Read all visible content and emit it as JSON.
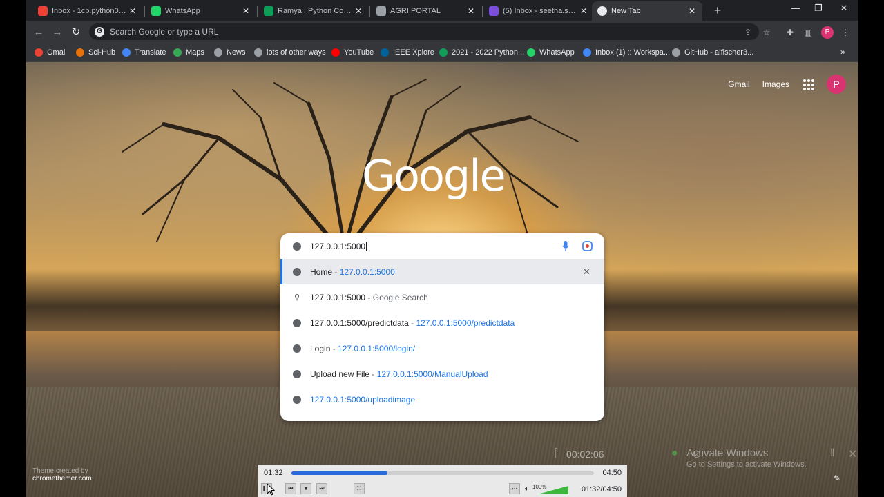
{
  "tabs": [
    {
      "title": "Inbox - 1cp.python02@",
      "favicon_color": "#ea4335",
      "active": false
    },
    {
      "title": "WhatsApp",
      "favicon_color": "#25d366",
      "active": false
    },
    {
      "title": "Ramya : Python Comm",
      "favicon_color": "#0f9d58",
      "active": false
    },
    {
      "title": "AGRI PORTAL",
      "favicon_color": "#9aa0a6",
      "active": false
    },
    {
      "title": "(5) Inbox - seetha.s@di",
      "favicon_color": "#7b4fd6",
      "active": false
    },
    {
      "title": "New Tab",
      "favicon_color": "#e8eaed",
      "active": true
    }
  ],
  "toolbar": {
    "omnibox_placeholder": "Search Google or type a URL",
    "profile_letter": "P"
  },
  "bookmarks": [
    {
      "label": "Gmail",
      "color": "#ea4335"
    },
    {
      "label": "Sci-Hub",
      "color": "#e8710a"
    },
    {
      "label": "Translate",
      "color": "#4285f4"
    },
    {
      "label": "Maps",
      "color": "#34a853"
    },
    {
      "label": "News",
      "color": "#9aa0a6"
    },
    {
      "label": "lots of other ways",
      "color": "#9aa0a6"
    },
    {
      "label": "YouTube",
      "color": "#ff0000"
    },
    {
      "label": "IEEE Xplore",
      "color": "#00629b"
    },
    {
      "label": "2021 - 2022 Python...",
      "color": "#0f9d58"
    },
    {
      "label": "WhatsApp",
      "color": "#25d366"
    },
    {
      "label": "Inbox (1) :: Workspa...",
      "color": "#4285f4"
    },
    {
      "label": "GitHub - alfischer3...",
      "color": "#9aa0a6"
    }
  ],
  "ntp": {
    "gmail": "Gmail",
    "images": "Images",
    "avatar_letter": "P",
    "logo": "Google"
  },
  "search": {
    "value": "127.0.0.1:5000",
    "suggestions": [
      {
        "kind": "history",
        "title": "Home",
        "url": "127.0.0.1:5000",
        "selected": true
      },
      {
        "kind": "search",
        "title": "127.0.0.1:5000",
        "suffix": "Google Search"
      },
      {
        "kind": "history",
        "title": "127.0.0.1:5000/predictdata",
        "url": "127.0.0.1:5000/predictdata"
      },
      {
        "kind": "history",
        "title": "Login",
        "url": "127.0.0.1:5000/login/"
      },
      {
        "kind": "history",
        "title": "Upload new File",
        "url": "127.0.0.1:5000/ManualUpload"
      },
      {
        "kind": "url",
        "url": "127.0.0.1:5000/uploadimage"
      }
    ]
  },
  "credit": {
    "line1": "Theme created by",
    "line2": "chromethemer.com"
  },
  "player": {
    "elapsed": "01:32",
    "total": "04:50",
    "progress_fraction": 0.317,
    "volume": "100%",
    "time_readout": "01:32/04:50"
  },
  "overlay": {
    "time": "00:02:06",
    "watermark_line1": "Activate Windows",
    "watermark_line2": "Go to Settings to activate Windows."
  }
}
